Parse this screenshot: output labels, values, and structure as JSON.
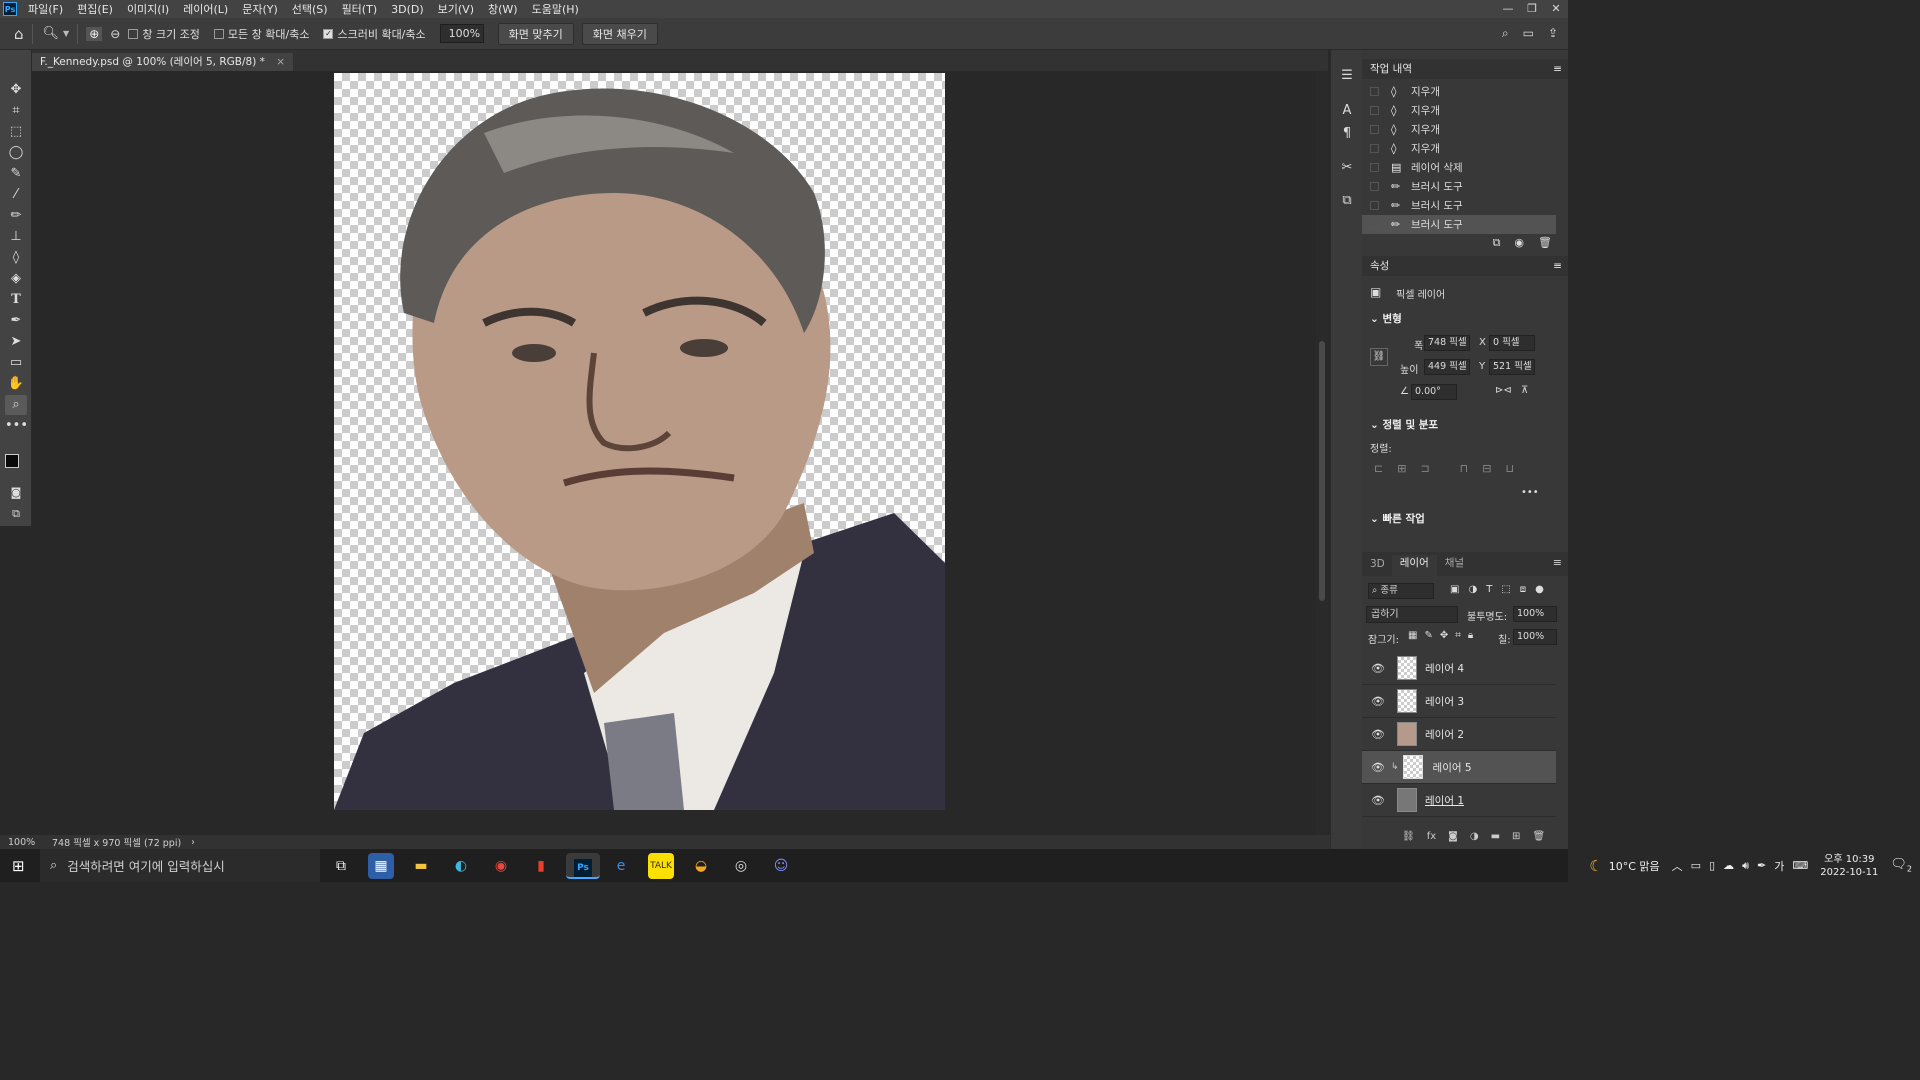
{
  "menubar": {
    "app_logo": "Ps",
    "items": [
      "파일(F)",
      "편집(E)",
      "이미지(I)",
      "레이어(L)",
      "문자(Y)",
      "선택(S)",
      "필터(T)",
      "3D(D)",
      "보기(V)",
      "창(W)",
      "도움말(H)"
    ],
    "window_controls": [
      "minimize-icon",
      "restore-icon",
      "close-icon"
    ]
  },
  "options": {
    "resize_windows": "창 크기 조정",
    "resize_windows_checked": false,
    "zoom_all_windows": "모든 창 확대/축소",
    "zoom_all_windows_checked": false,
    "scrubby_zoom": "스크러비 확대/축소",
    "scrubby_zoom_checked": true,
    "zoom_value": "100%",
    "fit_screen": "화면 맞추기",
    "fill_screen": "화면 채우기"
  },
  "document": {
    "tab_title": "F._Kennedy.psd @ 100% (레이어 5, RGB/8) *"
  },
  "status": {
    "zoom": "100%",
    "doc_info": "748 픽셀 x 970 픽셀 (72 ppi)"
  },
  "history": {
    "title": "작업 내역",
    "items": [
      {
        "label": "지우개",
        "icon": "eraser-icon"
      },
      {
        "label": "지우개",
        "icon": "eraser-icon"
      },
      {
        "label": "지우개",
        "icon": "eraser-icon"
      },
      {
        "label": "지우개",
        "icon": "eraser-icon"
      },
      {
        "label": "레이어 삭제",
        "icon": "layer-delete-icon"
      },
      {
        "label": "브러시 도구",
        "icon": "brush-icon"
      },
      {
        "label": "브러시 도구",
        "icon": "brush-icon"
      },
      {
        "label": "브러시 도구",
        "icon": "brush-icon"
      }
    ]
  },
  "properties": {
    "title": "속성",
    "layer_type": "픽셀 레이어",
    "transform_title": "변형",
    "width_label": "폭",
    "width_value": "748 픽셀",
    "x_label": "X",
    "x_value": "0 픽셀",
    "height_label": "높이",
    "height_value": "449 픽셀",
    "y_label": "Y",
    "y_value": "521 픽셀",
    "angle_value": "0.00°",
    "align_title": "정렬 및 분포",
    "align_label": "정렬:",
    "quick_actions": "빠른 작업"
  },
  "layers": {
    "tabs": [
      "3D",
      "레이어",
      "채널"
    ],
    "filter_kind": "종류",
    "blend_mode": "곱하기",
    "opacity_label": "불투명도:",
    "opacity_value": "100%",
    "lock_label": "잠그기:",
    "fill_label": "칠:",
    "fill_value": "100%",
    "items": [
      {
        "name": "레이어 4"
      },
      {
        "name": "레이어 3"
      },
      {
        "name": "레이어 2"
      },
      {
        "name": "레이어 5"
      },
      {
        "name": "레이어 1"
      }
    ]
  },
  "taskbar": {
    "search_placeholder": "검색하려면 여기에 입력하십시",
    "weather": "10°C 맑음",
    "ime": "가",
    "time": "오후 10:39",
    "date": "2022-10-11",
    "notification_count": "2"
  }
}
